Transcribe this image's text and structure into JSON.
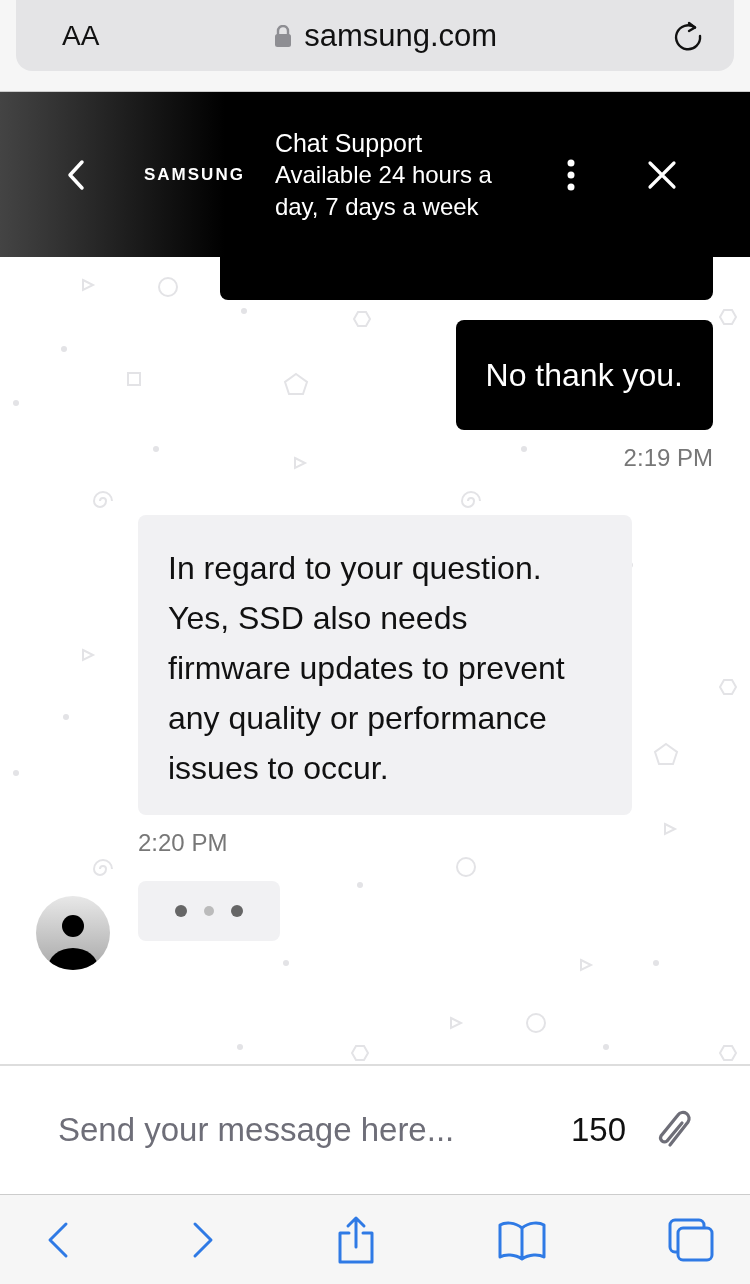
{
  "browser": {
    "text_size_label": "AA",
    "address": "samsung.com"
  },
  "header": {
    "logo": "SAMSUNG",
    "title": "Chat Support",
    "subtitle": "Available 24 hours a day, 7 days a week"
  },
  "messages": [
    {
      "kind": "user",
      "text": "No thank you.",
      "time": "2:19 PM"
    },
    {
      "kind": "agent",
      "text": "In regard to your question. Yes, SSD also needs firmware updates to prevent any quality or performance issues to occur.",
      "time": "2:20 PM"
    }
  ],
  "typing": true,
  "composer": {
    "placeholder": "Send your message here...",
    "counter": "150"
  }
}
